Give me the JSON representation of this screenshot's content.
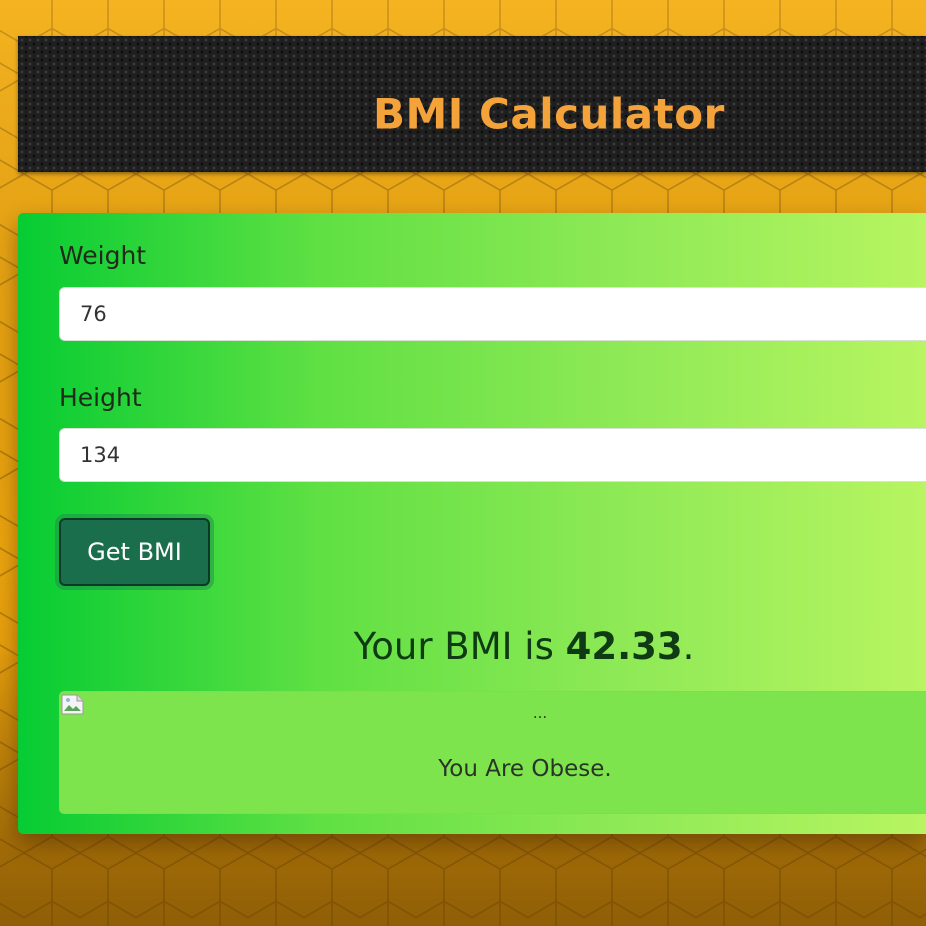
{
  "header": {
    "title": "BMI Calculator"
  },
  "form": {
    "weight_label": "Weight",
    "weight_value": "76",
    "height_label": "Height",
    "height_value": "134",
    "submit_label": "Get BMI"
  },
  "result": {
    "prefix": "Your BMI is ",
    "value": "42.33",
    "suffix": "."
  },
  "status": {
    "image_alt": "...",
    "message": "You Are Obese."
  },
  "colors": {
    "page_background": "#f2a90e",
    "header_background": "#1f1f1f",
    "title_color": "#f4a23a",
    "card_gradient_start": "#06cc33",
    "card_gradient_end": "#b7f561",
    "button_color": "#1a6e4b",
    "result_color": "#0e3a14",
    "status_background": "#7ee44d"
  },
  "icons": {
    "broken_image": "broken-image-icon"
  }
}
